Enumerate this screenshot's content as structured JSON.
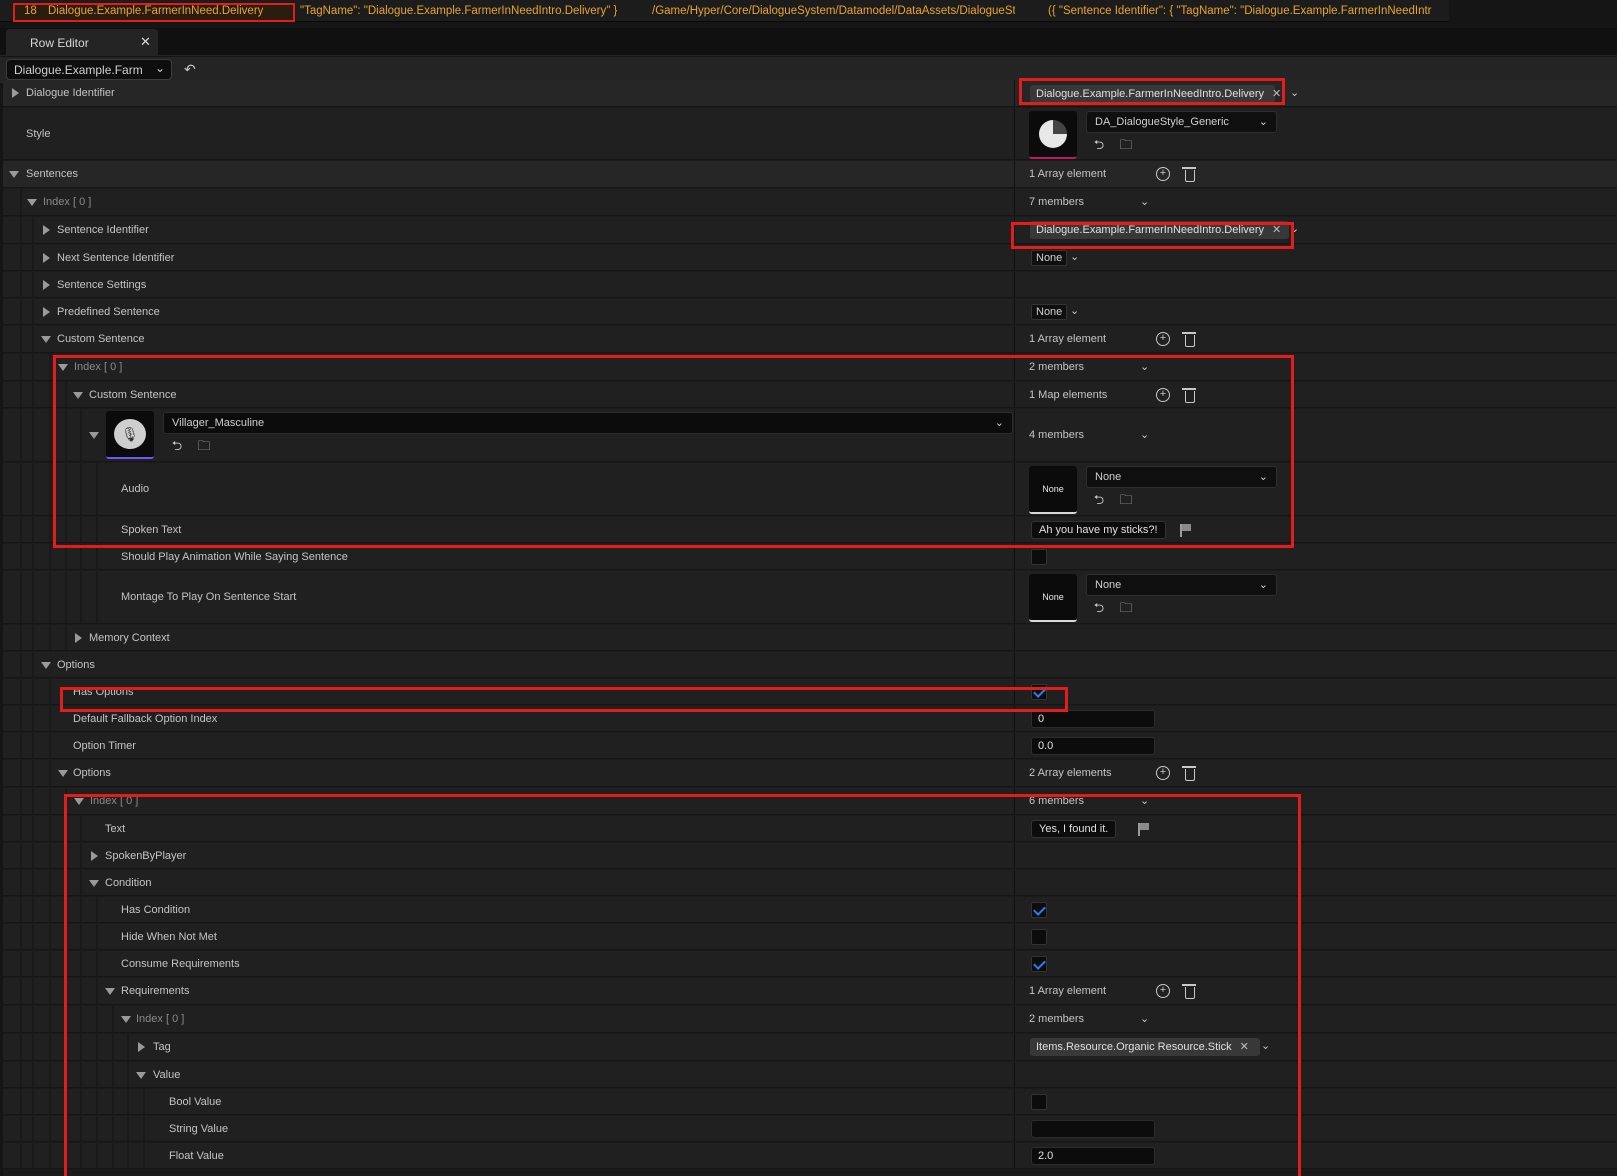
{
  "top_row": {
    "row_number": "18",
    "row_name": "Dialogue.Example.FarmerInNeed.Delivery",
    "col_tag": "\"TagName\": \"Dialogue.Example.FarmerInNeedIntro.Delivery\" }",
    "col_style": "/Game/Hyper/Core/DialogueSystem/Datamodel/DataAssets/DialogueSty",
    "col_sentences": "({ \"Sentence Identifier\": { \"TagName\": \"Dialogue.Example.FarmerInNeedIntr"
  },
  "tab": {
    "label": "Row Editor",
    "close": "✕"
  },
  "toolbar": {
    "row_selector": "Dialogue.Example.Farm",
    "back_icon": "↶"
  },
  "fields": {
    "dialogue_identifier": {
      "label": "Dialogue Identifier",
      "value": "Dialogue.Example.FarmerInNeedIntro.Delivery"
    },
    "style": {
      "label": "Style",
      "value": "DA_DialogueStyle_Generic"
    },
    "sentences": {
      "label": "Sentences",
      "value": "1 Array element"
    },
    "index0": {
      "label": "Index [ 0 ]",
      "value": "7 members"
    },
    "sentence_identifier": {
      "label": "Sentence Identifier",
      "value": "Dialogue.Example.FarmerInNeedIntro.Delivery"
    },
    "next_sentence_identifier": {
      "label": "Next Sentence Identifier",
      "value": "None"
    },
    "sentence_settings": {
      "label": "Sentence Settings"
    },
    "predefined_sentence": {
      "label": "Predefined Sentence",
      "value": "None"
    },
    "custom_sentence": {
      "label": "Custom Sentence",
      "value": "1 Array element"
    },
    "cs_index0": {
      "label": "Index [ 0 ]",
      "value": "2 members"
    },
    "cs_custom_sentence": {
      "label": "Custom Sentence",
      "value": "1 Map elements"
    },
    "speaker": {
      "key": "Villager_Masculine",
      "value": "4 members"
    },
    "audio": {
      "label": "Audio",
      "value": "None",
      "thumb": "None"
    },
    "spoken_text": {
      "label": "Spoken Text",
      "value": "Ah you have my sticks?!"
    },
    "should_play_animation": {
      "label": "Should Play Animation While Saying Sentence",
      "checked": false
    },
    "montage": {
      "label": "Montage To Play On Sentence Start",
      "value": "None",
      "thumb": "None"
    },
    "memory_context": {
      "label": "Memory Context"
    },
    "options": {
      "label": "Options"
    },
    "has_options": {
      "label": "Has Options",
      "checked": true
    },
    "default_fallback": {
      "label": "Default Fallback Option Index",
      "value": "0"
    },
    "option_timer": {
      "label": "Option Timer",
      "value": "0.0"
    },
    "options_array": {
      "label": "Options",
      "value": "2 Array elements"
    },
    "opt_index0": {
      "label": "Index [ 0 ]",
      "value": "6 members"
    },
    "text": {
      "label": "Text",
      "value": "Yes, I found it."
    },
    "spoken_by_player": {
      "label": "SpokenByPlayer"
    },
    "condition": {
      "label": "Condition"
    },
    "has_condition": {
      "label": "Has Condition",
      "checked": true
    },
    "hide_when_not_met": {
      "label": "Hide When Not Met",
      "checked": false
    },
    "consume_requirements": {
      "label": "Consume Requirements",
      "checked": true
    },
    "requirements": {
      "label": "Requirements",
      "value": "1 Array element"
    },
    "req_index0": {
      "label": "Index [ 0 ]",
      "value": "2 members"
    },
    "tag": {
      "label": "Tag",
      "value": "Items.Resource.Organic Resource.Stick"
    },
    "value": {
      "label": "Value"
    },
    "bool_value": {
      "label": "Bool Value",
      "checked": false
    },
    "string_value": {
      "label": "String Value",
      "value": ""
    },
    "float_value": {
      "label": "Float Value",
      "value": "2.0"
    }
  },
  "colors": {
    "highlight": "#e31c1c",
    "tag_text": "#e8a52a",
    "check": "#2a7ef0"
  }
}
